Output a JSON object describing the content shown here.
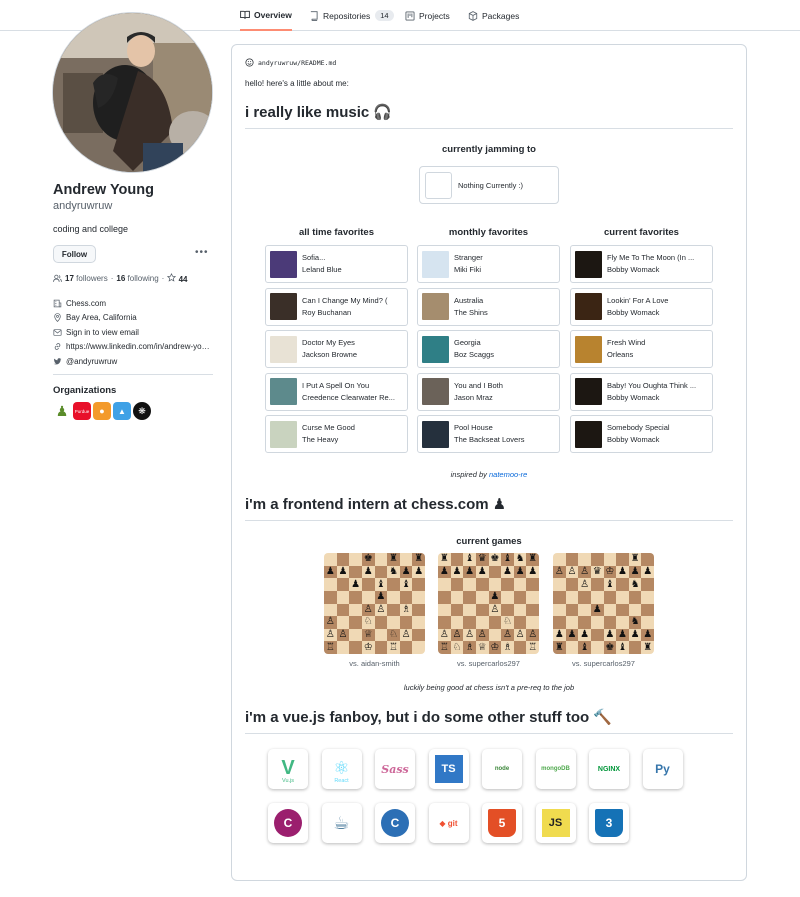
{
  "nav": {
    "tabs": [
      {
        "label": "Overview",
        "icon": "book-icon"
      },
      {
        "label": "Repositories",
        "icon": "repo-icon",
        "count": "14"
      },
      {
        "label": "Projects",
        "icon": "project-icon"
      },
      {
        "label": "Packages",
        "icon": "package-icon"
      }
    ]
  },
  "profile": {
    "name": "Andrew Young",
    "login": "andyruwruw",
    "bio": "coding and college",
    "follow_label": "Follow",
    "followers_count": "17",
    "followers_label": "followers",
    "following_count": "16",
    "following_label": "following",
    "stars_count": "44",
    "info": [
      {
        "icon": "organization-icon",
        "text": "Chess.com"
      },
      {
        "icon": "location-icon",
        "text": "Bay Area, California"
      },
      {
        "icon": "mail-icon",
        "text": "Sign in to view email"
      },
      {
        "icon": "link-icon",
        "text": "https://www.linkedin.com/in/andrew-young-b86306192/"
      },
      {
        "icon": "twitter-icon",
        "text": "@andyruwruw"
      }
    ],
    "orgs_title": "Organizations",
    "orgs": [
      {
        "name": "chess-pawn-org",
        "color": "#ffffff",
        "label": "♟"
      },
      {
        "name": "red-org",
        "color": "#e8102a",
        "label": "Purdue"
      },
      {
        "name": "orange-org",
        "color": "#f39a2b",
        "label": "●"
      },
      {
        "name": "blue-org",
        "color": "#3fa1e6",
        "label": "▲"
      },
      {
        "name": "black-org",
        "color": "#111111",
        "label": "❋"
      }
    ]
  },
  "readme": {
    "path_owner": "andyruwruw",
    "path_sep": "/",
    "path_file": "README.md",
    "hello": "hello! here's a little about me:",
    "music_heading": "i really like music 🎧",
    "jamming_title": "currently jamming to",
    "nothing_text": "Nothing Currently :)",
    "columns": [
      {
        "title": "all time favorites",
        "tracks": [
          {
            "title": "Sofia...",
            "artist": "Leland Blue",
            "color": "#4b3a78"
          },
          {
            "title": "Can I Change My Mind? (",
            "artist": "Roy Buchanan",
            "color": "#3a2f28"
          },
          {
            "title": "Doctor My Eyes",
            "artist": "Jackson Browne",
            "color": "#e8e2d5"
          },
          {
            "title": "I Put A Spell On You",
            "artist": "Creedence Clearwater Re...",
            "color": "#5d8a8c"
          },
          {
            "title": "Curse Me Good",
            "artist": "The Heavy",
            "color": "#c9d3bf"
          }
        ]
      },
      {
        "title": "monthly favorites",
        "tracks": [
          {
            "title": "Stranger",
            "artist": "Miki Fiki",
            "color": "#d6e4f0"
          },
          {
            "title": "Australia",
            "artist": "The Shins",
            "color": "#a58d6e"
          },
          {
            "title": "Georgia",
            "artist": "Boz Scaggs",
            "color": "#2f7f86"
          },
          {
            "title": "You and I Both",
            "artist": "Jason Mraz",
            "color": "#6b6259"
          },
          {
            "title": "Pool House",
            "artist": "The Backseat Lovers",
            "color": "#25303d"
          }
        ]
      },
      {
        "title": "current favorites",
        "tracks": [
          {
            "title": "Fly Me To The Moon (In ...",
            "artist": "Bobby Womack",
            "color": "#1c1712"
          },
          {
            "title": "Lookin' For A Love",
            "artist": "Bobby Womack",
            "color": "#3b2514"
          },
          {
            "title": "Fresh Wind",
            "artist": "Orleans",
            "color": "#b8832f"
          },
          {
            "title": "Baby! You Oughta Think ...",
            "artist": "Bobby Womack",
            "color": "#1c1712"
          },
          {
            "title": "Somebody Special",
            "artist": "Bobby Womack",
            "color": "#1c1712"
          }
        ]
      }
    ],
    "inspired_prefix": "inspired by",
    "inspired_link": "natemoo-re",
    "chess_heading": "i'm a frontend intern at chess.com ♟",
    "games_title": "current games",
    "games": [
      {
        "opponent": "vs. aidan-smith",
        "rows": [
          "...♚.♜.♜",
          "♟♟.♟.♞♟♟",
          "..♟.♝.♝.",
          "....♟...",
          "...♙♙.♗.",
          "♙..♘....",
          "♙♙.♕.♘♙.",
          "♖..♔.♖.."
        ]
      },
      {
        "opponent": "vs. supercarlos297",
        "rows": [
          "♜.♝♛♚♝♞♜",
          "♟♟♟♟.♟♟♟",
          "........",
          "....♟...",
          "....♙...",
          ".....♘..",
          "♙♙♙♙.♙♙♙",
          "♖♘♗♕♔♗.♖"
        ]
      },
      {
        "opponent": "vs. supercarlos297",
        "rows": [
          "......♜.",
          "♙♙♙♛♔♟♟♟",
          "..♙.♝.♞.",
          "........",
          "...♟....",
          "......♞.",
          "♟♟♟.♟♟♟♟",
          "♜.♝.♚♝.♜"
        ]
      }
    ],
    "lucky_text": "luckily being good at chess isn't a pre-req to the job",
    "vue_heading": "i'm a vue.js fanboy, but i do some other stuff too 🔨",
    "tech_row1": [
      {
        "name": "vuetify",
        "label": "V",
        "sub": "Vu.js",
        "color": "#41b883"
      },
      {
        "name": "react",
        "label": "⚛",
        "sub": "React",
        "color": "#61dafb"
      },
      {
        "name": "sass",
        "label": "Sass",
        "color": "#cd6799"
      },
      {
        "name": "typescript",
        "label": "TS",
        "color": "#3178c6"
      },
      {
        "name": "nodejs",
        "label": "node",
        "color": "#3c873a"
      },
      {
        "name": "mongodb",
        "label": "mongoDB",
        "color": "#4fa94d"
      },
      {
        "name": "nginx",
        "label": "NGINX",
        "color": "#009639"
      },
      {
        "name": "python",
        "label": "Py",
        "color": "#3776ab"
      }
    ],
    "tech_row2": [
      {
        "name": "csharp",
        "label": "C",
        "color": "#9b1f6e"
      },
      {
        "name": "java",
        "label": "☕",
        "color": "#5382a1"
      },
      {
        "name": "c",
        "label": "C",
        "color": "#2c6fb5"
      },
      {
        "name": "git",
        "label": "◆ git",
        "color": "#f05032"
      },
      {
        "name": "html5",
        "label": "5",
        "color": "#e34f26"
      },
      {
        "name": "javascript",
        "label": "JS",
        "color": "#f0db4f"
      },
      {
        "name": "css3",
        "label": "3",
        "color": "#1572b6"
      }
    ]
  }
}
